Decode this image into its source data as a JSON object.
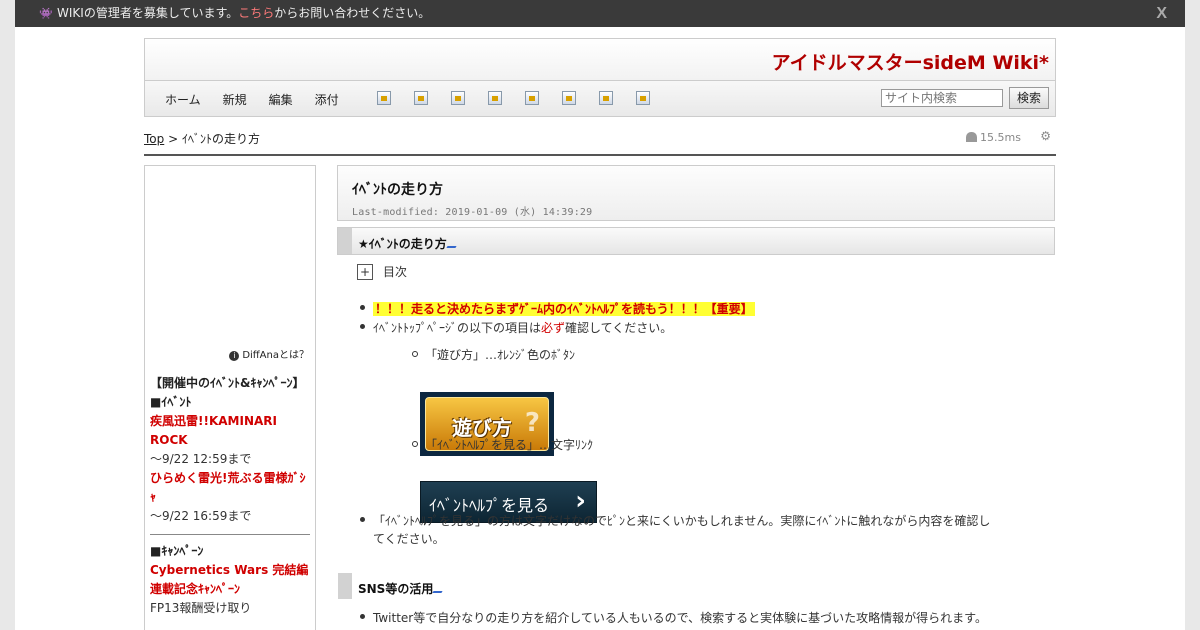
{
  "notice": {
    "text_before": "WIKIの管理者を募集しています。",
    "link": "こちら",
    "text_after": "からお問い合わせください。",
    "close": "X"
  },
  "header": {
    "site_title": "アイドルマスターsideM Wiki*"
  },
  "nav": {
    "menu": [
      "ホーム",
      "新規",
      "編集",
      "添付"
    ],
    "icons": [
      "copy-icon",
      "diff-icon",
      "backup-icon",
      "save-icon",
      "lock-icon",
      "list-icon",
      "recent-icon",
      "help-icon"
    ],
    "search_placeholder": "サイト内検索",
    "search_button": "検索"
  },
  "breadcrumb": {
    "top": "Top",
    "sep": " > ",
    "current": "ｲﾍﾞﾝﾄの走り方"
  },
  "timing": "15.5ms",
  "sidebar": {
    "diffana": "DiffAnaとは？",
    "heading": "【開催中のｲﾍﾞﾝﾄ&ｷｬﾝﾍﾟｰﾝ】",
    "event_label": "■ｲﾍﾞﾝﾄ",
    "event1": "疾風迅雷!!KAMINARI ROCK",
    "event1_until": "～9/22 12:59まで",
    "event2": "ひらめく雷光!荒ぶる雷様ｶﾞｼｬ",
    "event2_until": "～9/22 16:59まで",
    "campaign_label": "■ｷｬﾝﾍﾟｰﾝ",
    "campaign1": "Cybernetics Wars 完結編連載記念ｷｬﾝﾍﾟｰﾝ",
    "campaign1_note": "FP13報酬受け取り"
  },
  "page": {
    "title": "ｲﾍﾞﾝﾄの走り方",
    "last_modified": "Last-modified: 2019-01-09 (水) 14:39:29",
    "section1": "★ｲﾍﾞﾝﾄの走り方",
    "toc_toggle": "+",
    "toc_label": "目次",
    "item1": "！！！走ると決めたらまずｹﾞｰﾑ内のｲﾍﾞﾝﾄﾍﾙﾌﾟを読もう！！！【重要】",
    "item2_a": "ｲﾍﾞﾝﾄﾄｯﾌﾟﾍﾟｰｼﾞの以下の項目は",
    "item2_b": "必ず",
    "item2_c": "確認してください。",
    "sub1": "「遊び方」…ｵﾚﾝｼﾞ色のﾎﾞﾀﾝ",
    "asobi_button": "遊び方",
    "sub2": "「ｲﾍﾞﾝﾄﾍﾙﾌﾟを見る」…文字ﾘﾝｸ",
    "help_button": "ｲﾍﾞﾝﾄﾍﾙﾌﾟを見る",
    "item3_line1": "「ｲﾍﾞﾝﾄﾍﾙﾌﾟを見る」の方は文字だけなのでﾋﾟﾝと来にくいかもしれません。実際にｲﾍﾞﾝﾄに触れながら内容を確認し",
    "item3_line2": "てください。",
    "updown": "▲▼",
    "section2": "SNS等の活用",
    "item4": "Twitter等で自分なりの走り方を紹介している人もいるので、検索すると実体験に基づいた攻略情報が得られます。"
  }
}
